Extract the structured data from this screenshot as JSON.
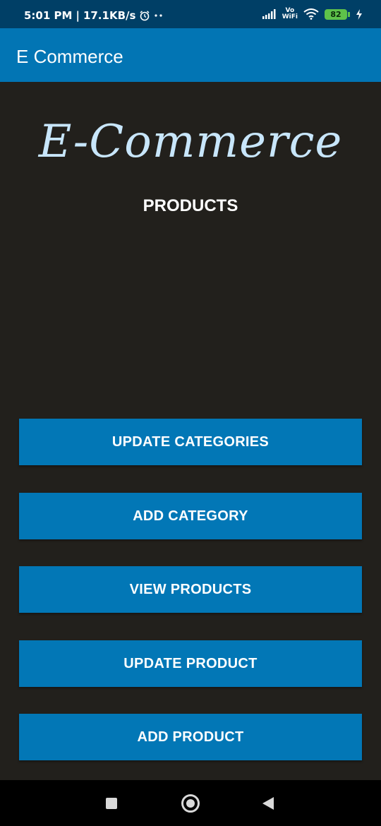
{
  "status_bar": {
    "time": "5:01 PM",
    "separator": "|",
    "network_speed": "17.1KB/s",
    "vo_line1": "Vo",
    "vo_line2": "WiFi",
    "battery_level": "82",
    "icons": [
      "alarm-icon",
      "more-dots-icon",
      "signal-icon",
      "wifi-icon",
      "battery-icon",
      "charging-icon"
    ]
  },
  "app_bar": {
    "title": "E Commerce",
    "color": "#0275b4"
  },
  "main": {
    "logo_text": "E-Commerce",
    "subtitle": "PRODUCTS",
    "buttons": [
      {
        "label": "UPDATE CATEGORIES"
      },
      {
        "label": "ADD CATEGORY"
      },
      {
        "label": "VIEW PRODUCTS"
      },
      {
        "label": "UPDATE PRODUCT"
      },
      {
        "label": "ADD PRODUCT"
      }
    ]
  },
  "nav_bar": {
    "icons": [
      "recent-apps-icon",
      "home-icon",
      "back-icon"
    ]
  },
  "colors": {
    "background": "#22201c",
    "button": "#0277b6",
    "logo": "#c8e6fb",
    "status_bar": "#003f66"
  }
}
